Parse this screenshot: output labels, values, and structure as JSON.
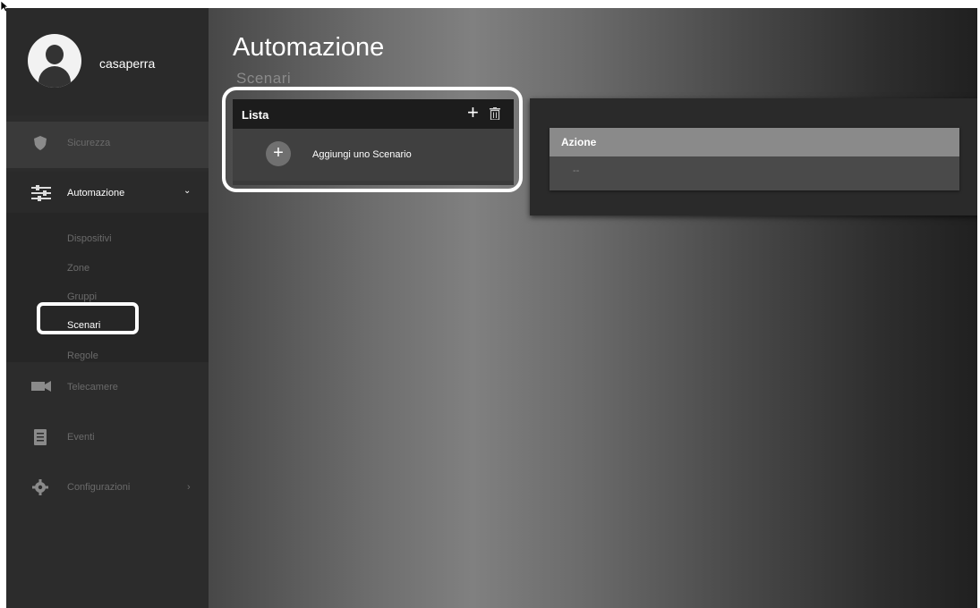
{
  "user": {
    "name": "casaperra"
  },
  "sidebar": {
    "security": {
      "label": "Sicurezza",
      "icon": "shield-icon"
    },
    "automation": {
      "label": "Automazione",
      "icon": "sliders-icon",
      "chevron": "⌄"
    },
    "submenu": [
      "Dispositivi",
      "Zone",
      "Gruppi",
      "Scenari",
      "Regole"
    ],
    "cameras": {
      "label": "Telecamere",
      "icon": "camera-icon"
    },
    "events": {
      "label": "Eventi",
      "icon": "document-icon"
    },
    "settings": {
      "label": "Configurazioni",
      "icon": "gear-icon",
      "chevron": "›"
    }
  },
  "page": {
    "title": "Automazione",
    "subtitle": "Scenari"
  },
  "list_panel": {
    "header": "Lista",
    "add_icon": "+",
    "add_row_label": "Aggiungi uno Scenario"
  },
  "action_panel": {
    "header": "Azione",
    "value": "--"
  },
  "colors": {
    "highlight": "#ffffff",
    "sidebar": "#2c2c2c"
  }
}
